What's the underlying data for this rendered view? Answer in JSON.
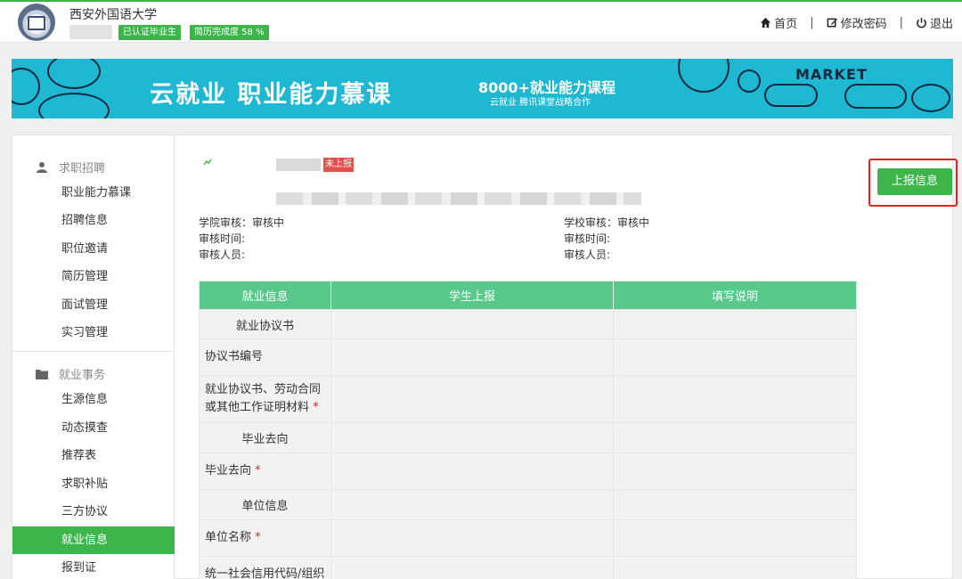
{
  "header": {
    "university": "西安外国语大学",
    "badge_certified": "已认证毕业生",
    "badge_resume": "简历完成度 58 %",
    "nav": {
      "home": "首页",
      "change_password": "修改密码",
      "logout": "退出"
    }
  },
  "banner": {
    "title": "云就业  职业能力慕课",
    "sub_title": "8000+就业能力课程",
    "sub_caption": "云就业  腾讯课堂战略合作",
    "market_text": "MARKET"
  },
  "sidebar": {
    "group1": "求职招聘",
    "group1_items": [
      "职业能力慕课",
      "招聘信息",
      "职位邀请",
      "简历管理",
      "面试管理",
      "实习管理"
    ],
    "group2": "就业事务",
    "group2_items": [
      "生源信息",
      "动态摸查",
      "推荐表",
      "求职补贴",
      "三方协议",
      "就业信息",
      "报到证"
    ],
    "active": "就业信息"
  },
  "main": {
    "status_tag": "未上报",
    "report_button": "上报信息",
    "college_review": {
      "status": "学院审核：审核中",
      "time": "审核时间:",
      "reviewer": "审核人员:"
    },
    "school_review": {
      "status": "学校审核：审核中",
      "time": "审核时间:",
      "reviewer": "审核人员:"
    },
    "table": {
      "headers": [
        "就业信息",
        "学生上报",
        "填写说明"
      ],
      "rows": [
        {
          "label": "就业协议书",
          "section": true
        },
        {
          "label": "协议书编号"
        },
        {
          "label": "就业协议书、劳动合同或其他工作证明材料",
          "required": true
        },
        {
          "label": "毕业去向",
          "section": true
        },
        {
          "label": "毕业去向",
          "required": true
        },
        {
          "label": "单位信息",
          "section": true
        },
        {
          "label": "单位名称",
          "required": true
        },
        {
          "label": "统一社会信用代码/组织"
        }
      ]
    }
  }
}
